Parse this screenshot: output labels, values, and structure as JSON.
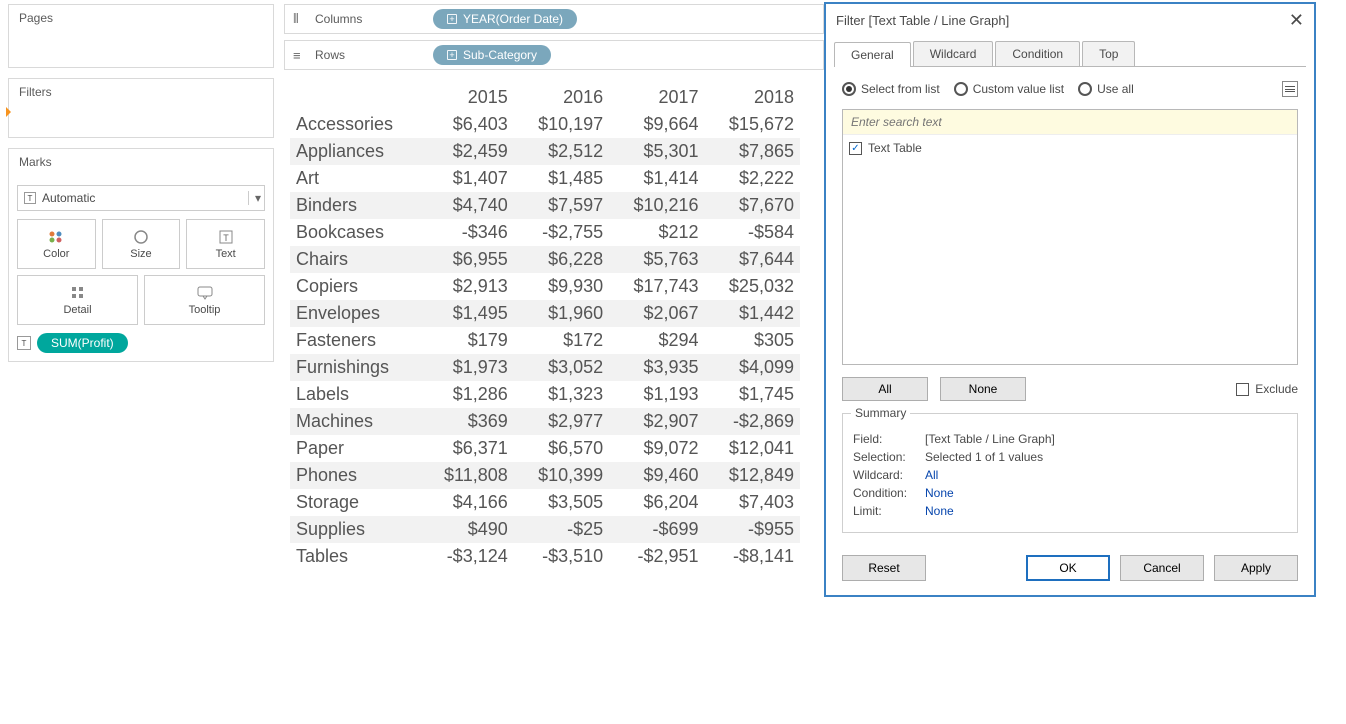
{
  "panels": {
    "pages": "Pages",
    "filters": "Filters",
    "marks": "Marks"
  },
  "marks": {
    "type_label": "Automatic",
    "cells": {
      "color": "Color",
      "size": "Size",
      "text": "Text",
      "detail": "Detail",
      "tooltip": "Tooltip"
    },
    "pill": "SUM(Profit)"
  },
  "shelves": {
    "columns_label": "Columns",
    "rows_label": "Rows",
    "columns_pill": "YEAR(Order Date)",
    "rows_pill": "Sub-Category"
  },
  "chart_data": {
    "type": "table",
    "title": "",
    "years": [
      "2015",
      "2016",
      "2017",
      "2018"
    ],
    "rows": [
      {
        "name": "Accessories",
        "vals": [
          "$6,403",
          "$10,197",
          "$9,664",
          "$15,672"
        ]
      },
      {
        "name": "Appliances",
        "vals": [
          "$2,459",
          "$2,512",
          "$5,301",
          "$7,865"
        ]
      },
      {
        "name": "Art",
        "vals": [
          "$1,407",
          "$1,485",
          "$1,414",
          "$2,222"
        ]
      },
      {
        "name": "Binders",
        "vals": [
          "$4,740",
          "$7,597",
          "$10,216",
          "$7,670"
        ]
      },
      {
        "name": "Bookcases",
        "vals": [
          "-$346",
          "-$2,755",
          "$212",
          "-$584"
        ]
      },
      {
        "name": "Chairs",
        "vals": [
          "$6,955",
          "$6,228",
          "$5,763",
          "$7,644"
        ]
      },
      {
        "name": "Copiers",
        "vals": [
          "$2,913",
          "$9,930",
          "$17,743",
          "$25,032"
        ]
      },
      {
        "name": "Envelopes",
        "vals": [
          "$1,495",
          "$1,960",
          "$2,067",
          "$1,442"
        ]
      },
      {
        "name": "Fasteners",
        "vals": [
          "$179",
          "$172",
          "$294",
          "$305"
        ]
      },
      {
        "name": "Furnishings",
        "vals": [
          "$1,973",
          "$3,052",
          "$3,935",
          "$4,099"
        ]
      },
      {
        "name": "Labels",
        "vals": [
          "$1,286",
          "$1,323",
          "$1,193",
          "$1,745"
        ]
      },
      {
        "name": "Machines",
        "vals": [
          "$369",
          "$2,977",
          "$2,907",
          "-$2,869"
        ]
      },
      {
        "name": "Paper",
        "vals": [
          "$6,371",
          "$6,570",
          "$9,072",
          "$12,041"
        ]
      },
      {
        "name": "Phones",
        "vals": [
          "$11,808",
          "$10,399",
          "$9,460",
          "$12,849"
        ]
      },
      {
        "name": "Storage",
        "vals": [
          "$4,166",
          "$3,505",
          "$6,204",
          "$7,403"
        ]
      },
      {
        "name": "Supplies",
        "vals": [
          "$490",
          "-$25",
          "-$699",
          "-$955"
        ]
      },
      {
        "name": "Tables",
        "vals": [
          "-$3,124",
          "-$3,510",
          "-$2,951",
          "-$8,141"
        ]
      }
    ]
  },
  "dialog": {
    "title": "Filter [Text Table / Line Graph]",
    "tabs": {
      "general": "General",
      "wildcard": "Wildcard",
      "condition": "Condition",
      "top": "Top"
    },
    "radios": {
      "select": "Select from list",
      "custom": "Custom value list",
      "useall": "Use all"
    },
    "search_placeholder": "Enter search text",
    "list_item": "Text Table",
    "all": "All",
    "none": "None",
    "exclude": "Exclude",
    "summary": {
      "legend": "Summary",
      "field_k": "Field:",
      "field_v": "[Text Table / Line Graph]",
      "sel_k": "Selection:",
      "sel_v": "Selected 1 of 1 values",
      "wild_k": "Wildcard:",
      "wild_v": "All",
      "cond_k": "Condition:",
      "cond_v": "None",
      "lim_k": "Limit:",
      "lim_v": "None"
    },
    "buttons": {
      "reset": "Reset",
      "ok": "OK",
      "cancel": "Cancel",
      "apply": "Apply"
    }
  }
}
